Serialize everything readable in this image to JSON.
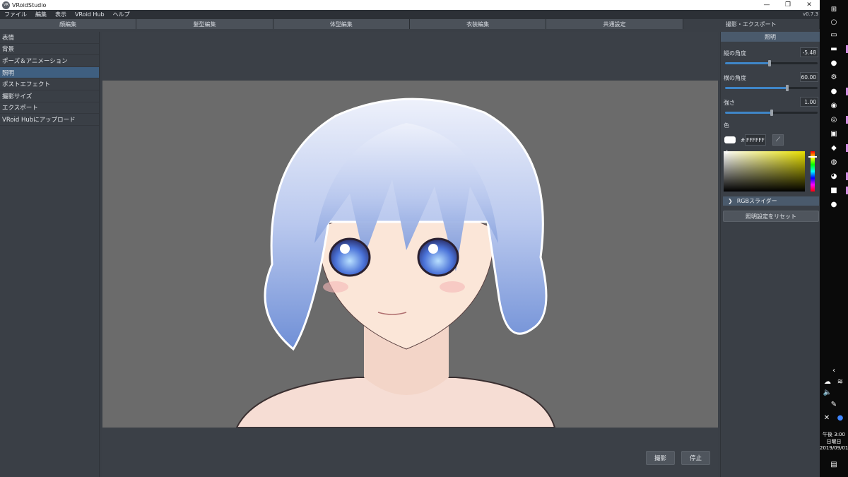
{
  "window": {
    "title": "VRoidStudio",
    "logo": "VR",
    "minimize": "—",
    "maximize": "❐",
    "close": "✕"
  },
  "menu": {
    "items": [
      "ファイル",
      "編集",
      "表示",
      "VRoid Hub",
      "ヘルプ"
    ],
    "version": "v0.7.3"
  },
  "tabs": [
    {
      "label": "顔編集",
      "active": false
    },
    {
      "label": "髪型編集",
      "active": false
    },
    {
      "label": "体型編集",
      "active": false
    },
    {
      "label": "衣装編集",
      "active": false
    },
    {
      "label": "共通設定",
      "active": false
    },
    {
      "label": "撮影・エクスポート",
      "active": true
    }
  ],
  "left_nav": {
    "items": [
      {
        "label": "表情",
        "active": false
      },
      {
        "label": "背景",
        "active": false
      },
      {
        "label": "ポーズ＆アニメーション",
        "active": false
      },
      {
        "label": "照明",
        "active": true
      },
      {
        "label": "ポストエフェクト",
        "active": false
      },
      {
        "label": "撮影サイズ",
        "active": false
      },
      {
        "label": "エクスポート",
        "active": false
      },
      {
        "label": "VRoid Hubにアップロード",
        "active": false
      }
    ]
  },
  "viewport": {
    "capture_button": "撮影",
    "stop_button": "停止"
  },
  "lighting_panel": {
    "title": "照明",
    "vertical_angle": {
      "label": "縦の角度",
      "value": "-5.48",
      "fraction": 0.48
    },
    "horizontal_angle": {
      "label": "横の角度",
      "value": "60.00",
      "fraction": 0.67
    },
    "intensity": {
      "label": "強さ",
      "value": "1.00",
      "fraction": 0.5
    },
    "color": {
      "label": "色",
      "hash": "#",
      "hex": "FFFFFF",
      "swatch": "#FFFFFF",
      "picker_icon": "eyedropper-icon"
    },
    "rgb_slider_label": "RGBスライダー",
    "reset_label": "照明設定をリセット"
  },
  "taskbar": {
    "time": "午後 3:00",
    "weekday": "日曜日",
    "date": "2019/09/01"
  },
  "colors": {
    "accent": "#3f86c8",
    "panel": "#3a3f46",
    "viewport": "#6b6b6b",
    "active_item": "#3f5f80"
  }
}
